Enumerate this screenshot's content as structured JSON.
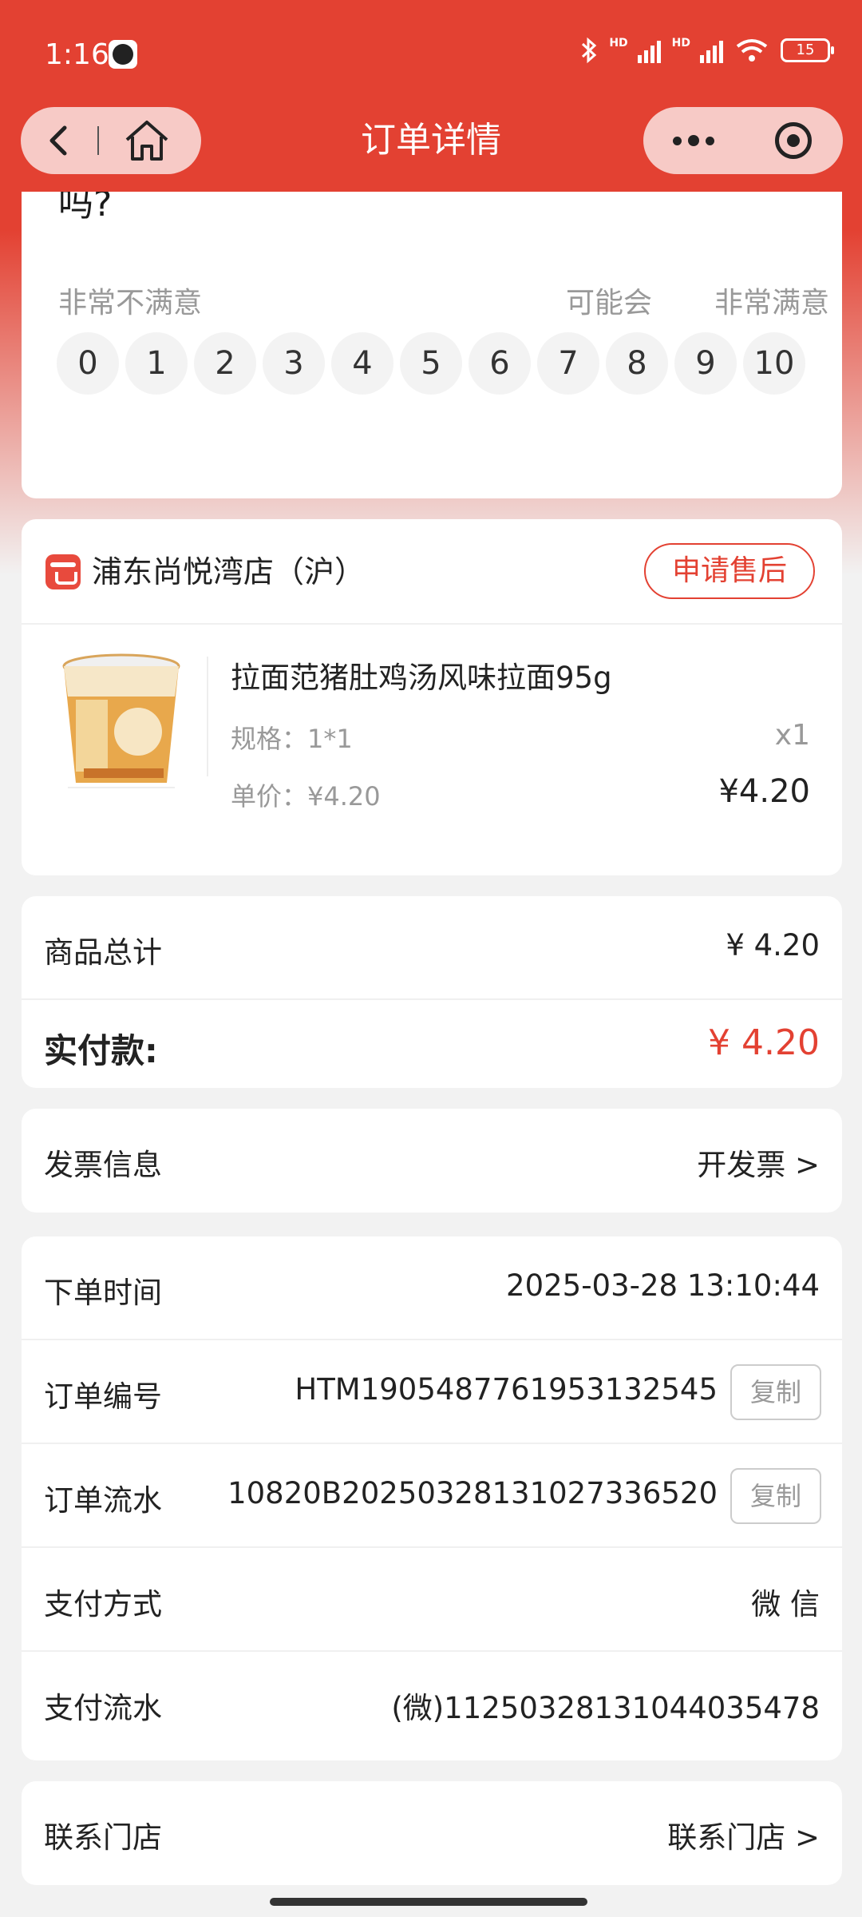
{
  "status_bar": {
    "time": "1:16",
    "battery": "15"
  },
  "nav": {
    "title": "订单详情"
  },
  "survey": {
    "question": "基于最近一次购买，您愿意向其他人推荐好特卖吗?",
    "label_low": "非常不满意",
    "label_mid": "可能会",
    "label_high": "非常满意",
    "scores": [
      "0",
      "1",
      "2",
      "3",
      "4",
      "5",
      "6",
      "7",
      "8",
      "9",
      "10"
    ]
  },
  "store": {
    "name": "浦东尚悦湾店（沪）",
    "after_sale": "申请售后"
  },
  "product": {
    "name": "拉面范猪肚鸡汤风味拉面95g",
    "spec": "规格：1*1",
    "qty": "x1",
    "unit_price": "单价：¥4.20",
    "total": "¥4.20"
  },
  "totals": {
    "subtotal_label": "商品总计",
    "subtotal_value": "¥ 4.20",
    "paid_label": "实付款:",
    "paid_value": "¥ 4.20",
    "paid_color": "#e34132"
  },
  "invoice": {
    "label": "发票信息",
    "action": "开发票 >"
  },
  "order_info": {
    "time_label": "下单时间",
    "time_value": "2025-03-28 13:10:44",
    "order_no_label": "订单编号",
    "order_no_value": "HTM1905487761953132545",
    "serial_label": "订单流水",
    "serial_value": "10820B20250328131027336520",
    "copy_label": "复制",
    "pay_method_label": "支付方式",
    "pay_method_value": "微 信",
    "pay_serial_label": "支付流水",
    "pay_serial_value": "(微)112503281310440354​78"
  },
  "contact": {
    "label": "联系门店",
    "action": "联系门店 >"
  },
  "colors": {
    "brand": "#e34132"
  }
}
